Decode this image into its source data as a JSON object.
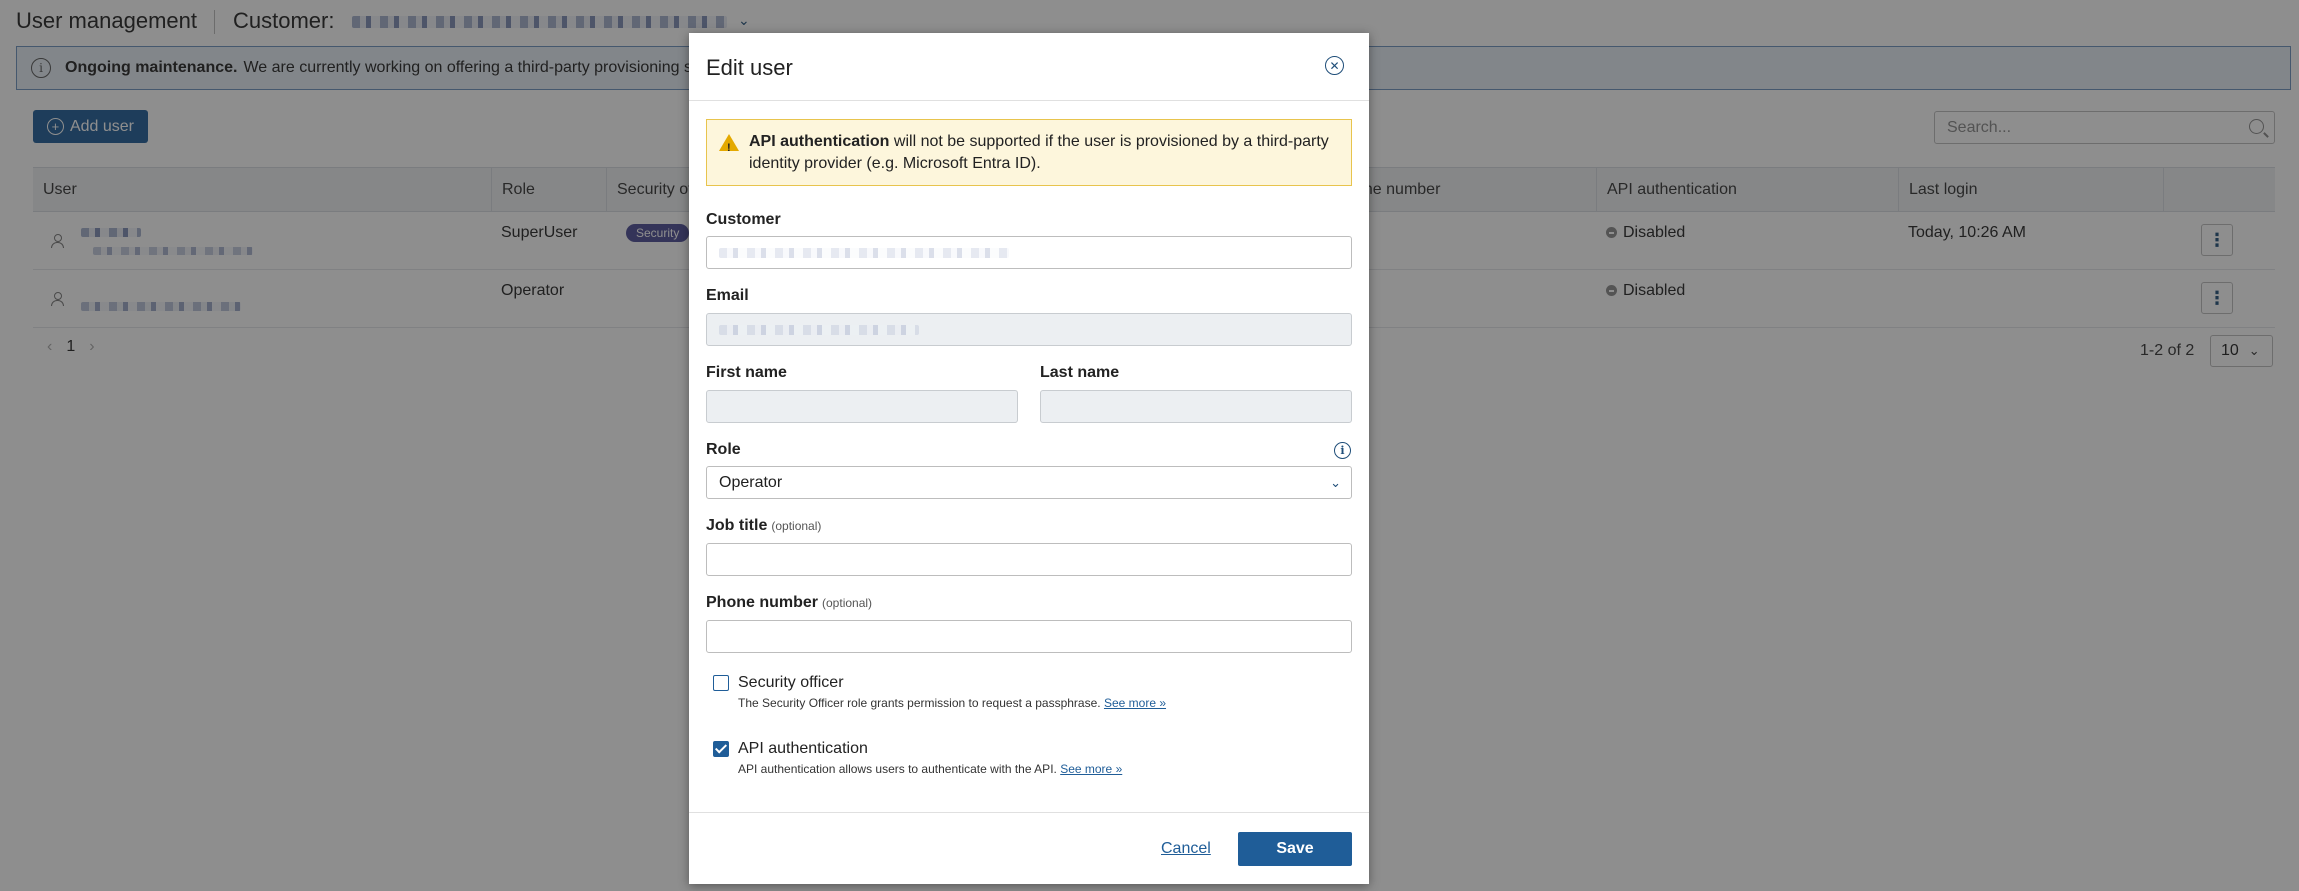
{
  "header": {
    "title": "User management",
    "customer_label": "Customer:"
  },
  "banner": {
    "bold": "Ongoing maintenance.",
    "text": "We are currently working on offering a third-party provisioning solu"
  },
  "toolbar": {
    "add_user": "Add user",
    "search_placeholder": "Search..."
  },
  "table": {
    "columns": [
      "User",
      "Role",
      "Security office",
      "one number",
      "API authentication",
      "Last login"
    ],
    "rows": [
      {
        "role": "SuperUser",
        "security": "Security",
        "api": "Disabled",
        "last_login": "Today, 10:26 AM"
      },
      {
        "role": "Operator",
        "security": "",
        "api": "Disabled",
        "last_login": ""
      }
    ]
  },
  "pagination": {
    "prev": "‹",
    "page": "1",
    "next": "›",
    "range": "1-2 of 2",
    "per_page": "10"
  },
  "modal": {
    "title": "Edit user",
    "warning_bold": "API authentication",
    "warning_text": "will not be supported if the user is provisioned by a third-party identity provider (e.g. Microsoft Entra ID).",
    "customer_label": "Customer",
    "email_label": "Email",
    "first_name_label": "First name",
    "last_name_label": "Last name",
    "role_label": "Role",
    "role_value": "Operator",
    "job_title_label": "Job title",
    "phone_label": "Phone number",
    "optional": "(optional)",
    "security_officer": {
      "label": "Security officer",
      "checked": false,
      "desc": "The Security Officer role grants permission to request a passphrase.",
      "link": "See more »"
    },
    "api_auth": {
      "label": "API authentication",
      "checked": true,
      "desc": "API authentication allows users to authenticate with the API.",
      "link": "See more »"
    },
    "cancel": "Cancel",
    "save": "Save"
  },
  "colors": {
    "primary": "#1f5d98",
    "badge": "#4b4a94",
    "warning_bg": "#fdf6dc",
    "warning_border": "#e8c44d",
    "banner_bg": "#e7eef6"
  }
}
